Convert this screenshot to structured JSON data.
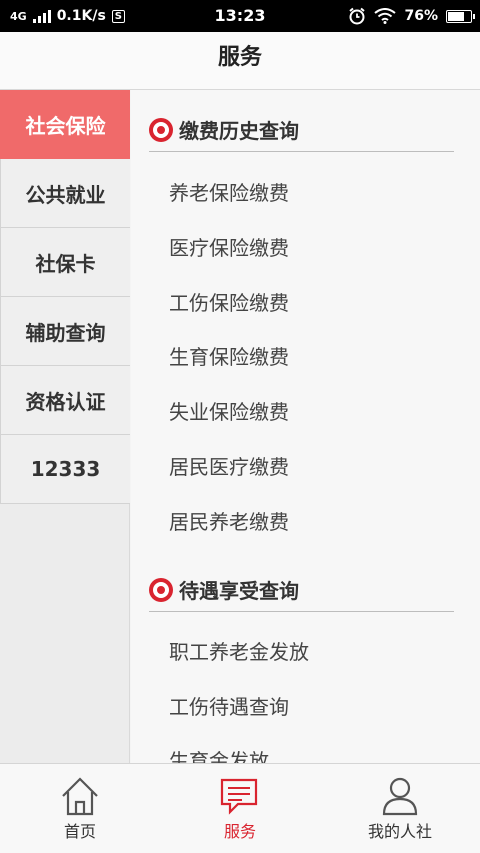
{
  "status_bar": {
    "network": "4G",
    "speed": "0.1K/s",
    "s_badge": "S",
    "time": "13:23",
    "battery_percent": "76%",
    "battery_level": 0.76
  },
  "header": {
    "title": "服务"
  },
  "sidebar": {
    "items": [
      {
        "label": "社会保险",
        "active": true
      },
      {
        "label": "公共就业"
      },
      {
        "label": "社保卡"
      },
      {
        "label": "辅助查询"
      },
      {
        "label": "资格认证"
      },
      {
        "label": "12333"
      }
    ]
  },
  "sections": [
    {
      "title": "缴费历史查询",
      "items": [
        "养老保险缴费",
        "医疗保险缴费",
        "工伤保险缴费",
        "生育保险缴费",
        "失业保险缴费",
        "居民医疗缴费",
        "居民养老缴费"
      ]
    },
    {
      "title": "待遇享受查询",
      "items": [
        "职工养老金发放",
        "工伤待遇查询",
        "生育金发放"
      ]
    }
  ],
  "bottom_nav": {
    "items": [
      {
        "label": "首页",
        "icon": "home-icon"
      },
      {
        "label": "服务",
        "icon": "chat-icon",
        "active": true
      },
      {
        "label": "我的人社",
        "icon": "user-icon"
      }
    ]
  },
  "colors": {
    "accent": "#d9242f",
    "sidebar_active": "#f06a6a"
  }
}
